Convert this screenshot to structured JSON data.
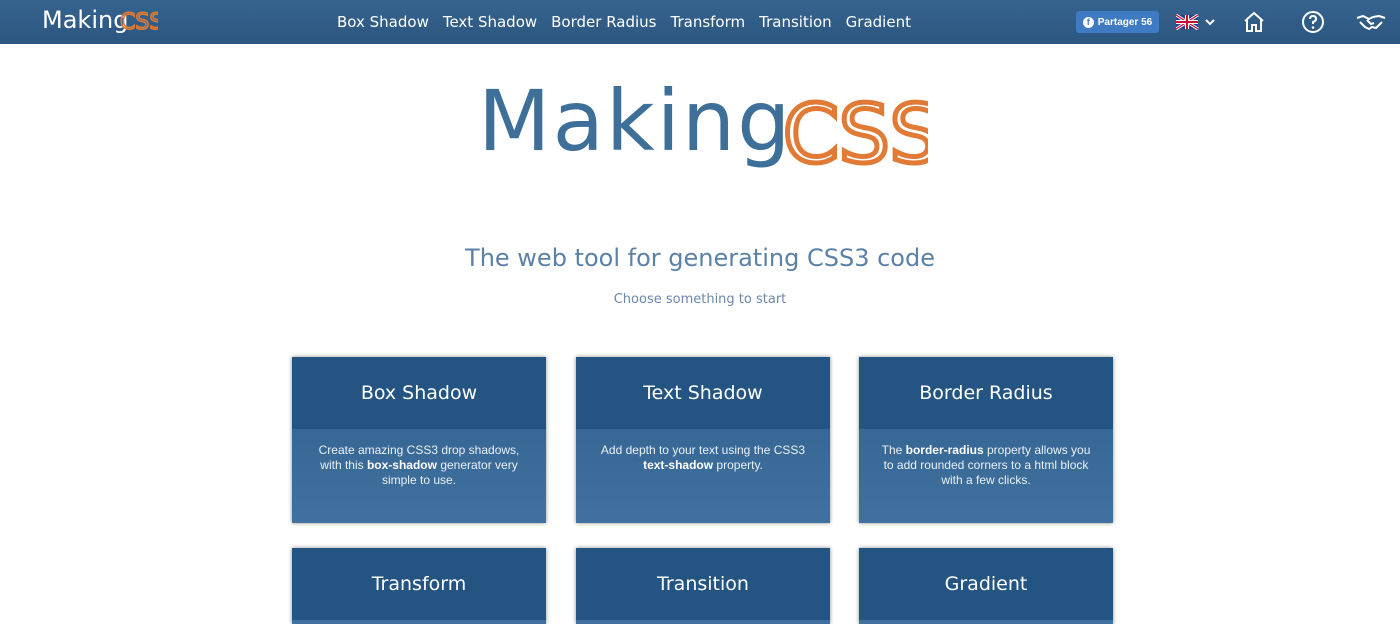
{
  "brand": {
    "making": "Making",
    "css": "CSS"
  },
  "nav": [
    {
      "label": "Box Shadow"
    },
    {
      "label": "Text Shadow"
    },
    {
      "label": "Border Radius"
    },
    {
      "label": "Transform"
    },
    {
      "label": "Transition"
    },
    {
      "label": "Gradient"
    }
  ],
  "share": {
    "label": "Partager 56"
  },
  "icons": {
    "language": "uk-flag-icon",
    "home": "home-icon",
    "help": "question-circle-icon",
    "partner": "handshake-icon"
  },
  "hero": {
    "tagline": "The web tool for generating CSS3 code",
    "subtag": "Choose something to start"
  },
  "cards": [
    {
      "title": "Box Shadow",
      "desc_a": "Create amazing CSS3 drop shadows, with this ",
      "desc_bold": "box-shadow",
      "desc_b": " generator very simple to use."
    },
    {
      "title": "Text Shadow",
      "desc_a": "Add depth to your text using the CSS3 ",
      "desc_bold": "text-shadow",
      "desc_b": " property."
    },
    {
      "title": "Border Radius",
      "desc_a": "The ",
      "desc_bold": "border-radius",
      "desc_b": " property allows you to add rounded corners to a html block with a few clicks."
    },
    {
      "title": "Transform",
      "desc_a": "",
      "desc_bold": "",
      "desc_b": ""
    },
    {
      "title": "Transition",
      "desc_a": "",
      "desc_bold": "",
      "desc_b": ""
    },
    {
      "title": "Gradient",
      "desc_a": "",
      "desc_bold": "",
      "desc_b": ""
    }
  ],
  "colors": {
    "navbar": "#2f5c86",
    "brand_blue": "#3d6f99",
    "brand_orange": "#e07a35",
    "card_head": "#245582",
    "tagline": "#5b81a7"
  }
}
